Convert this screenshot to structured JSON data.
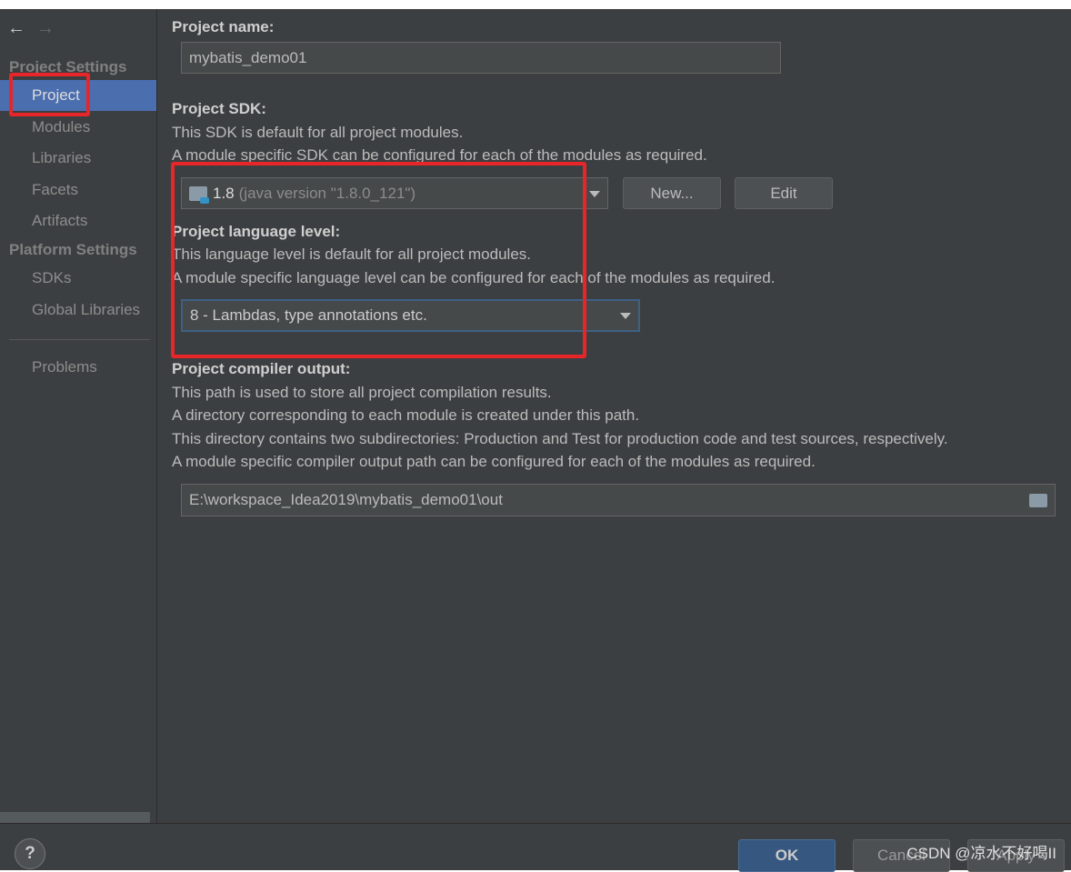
{
  "sidebar": {
    "back": "←",
    "forward": "→",
    "group1": "Project Settings",
    "items1": [
      "Project",
      "Modules",
      "Libraries",
      "Facets",
      "Artifacts"
    ],
    "group2": "Platform Settings",
    "items2": [
      "SDKs",
      "Global Libraries"
    ],
    "problems": "Problems"
  },
  "main": {
    "name_label": "Project name:",
    "name_value": "mybatis_demo01",
    "sdk_label": "Project SDK:",
    "sdk_desc1": "This SDK is default for all project modules.",
    "sdk_desc2": "A module specific SDK can be configured for each of the modules as required.",
    "sdk_version": "1.8",
    "sdk_detail": "(java version \"1.8.0_121\")",
    "new_btn": "New...",
    "edit_btn": "Edit",
    "lang_label": "Project language level:",
    "lang_desc1": "This language level is default for all project modules.",
    "lang_desc2": "A module specific language level can be configured for each of the modules as required.",
    "lang_value": "8 - Lambdas, type annotations etc.",
    "out_label": "Project compiler output:",
    "out_desc1": "This path is used to store all project compilation results.",
    "out_desc2": "A directory corresponding to each module is created under this path.",
    "out_desc3": "This directory contains two subdirectories: Production and Test for production code and test sources, respectively.",
    "out_desc4": "A module specific compiler output path can be configured for each of the modules as required.",
    "out_value": "E:\\workspace_Idea2019\\mybatis_demo01\\out"
  },
  "footer": {
    "help": "?",
    "ok": "OK",
    "cancel": "Cancel",
    "apply": "Apply",
    "watermark": "CSDN @凉水不好喝II"
  },
  "colors": {
    "selection": "#4b6eaf",
    "highlight": "#e8262a",
    "ok": "#365880"
  }
}
